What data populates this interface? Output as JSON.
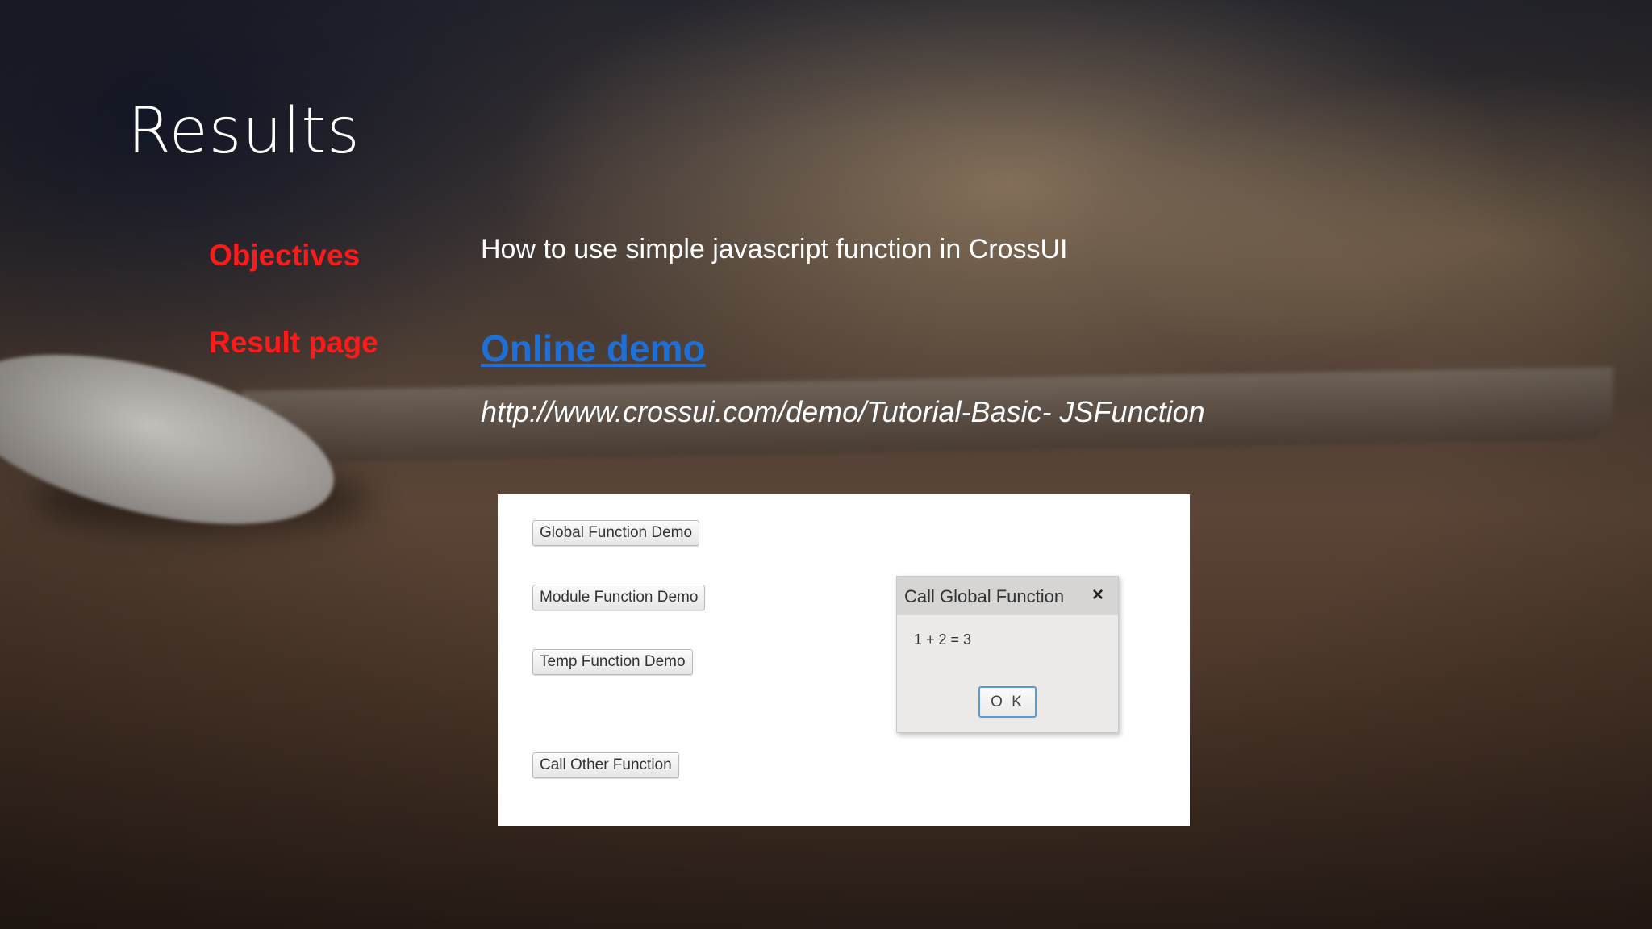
{
  "slide": {
    "title": "Results",
    "objectives_label": "Objectives",
    "objectives_text": "How to use simple javascript function in CrossUI",
    "result_label": "Result page",
    "demo_link": "Online demo",
    "demo_url": "http://www.crossui.com/demo/Tutorial-Basic- JSFunction"
  },
  "demo": {
    "buttons": [
      {
        "label": "Global Function Demo"
      },
      {
        "label": "Module Function Demo"
      },
      {
        "label": "Temp Function Demo"
      },
      {
        "label": "Call Other Function"
      }
    ],
    "dialog": {
      "title": "Call Global Function",
      "close_icon": "×",
      "message": "1 + 2 = 3",
      "ok_label": "O K"
    }
  },
  "colors": {
    "label_red": "#ff1a1a",
    "link_blue": "#1f6fd9",
    "dialog_ok_border": "#5b9bd5"
  }
}
